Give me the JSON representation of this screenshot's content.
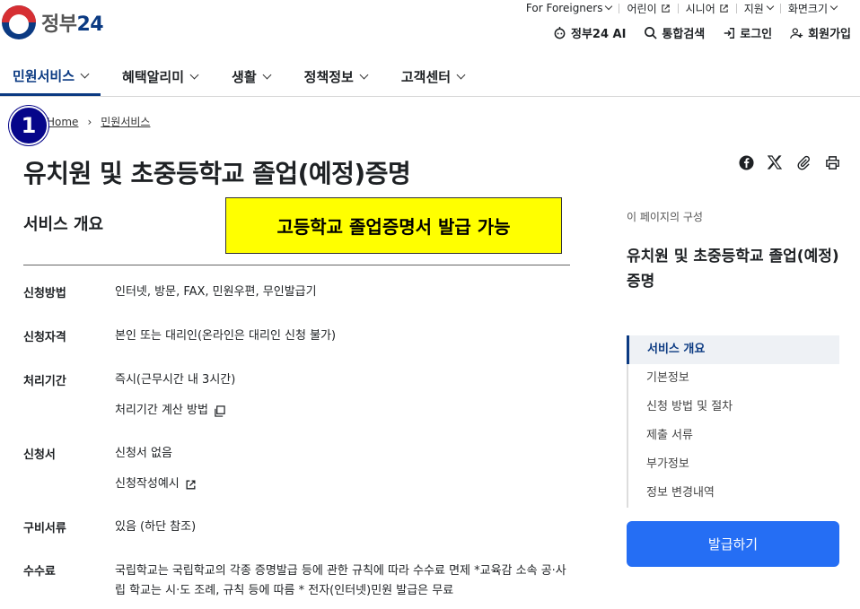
{
  "top_util": {
    "items": [
      {
        "label": "For Foreigners",
        "icon": "chevron-down-icon"
      },
      {
        "label": "어린이",
        "icon": "external-link-icon"
      },
      {
        "label": "시니어",
        "icon": "external-link-icon"
      },
      {
        "label": "지원",
        "icon": "chevron-down-icon"
      },
      {
        "label": "화면크기",
        "icon": "chevron-down-icon"
      }
    ]
  },
  "logo": {
    "text_a": "정부",
    "text_b": "24"
  },
  "util2": {
    "ai": "정부24 AI",
    "search": "통합검색",
    "login": "로그인",
    "signup": "회원가입"
  },
  "gnb": {
    "items": [
      "민원서비스",
      "혜택알리미",
      "생활",
      "정책정보",
      "고객센터"
    ]
  },
  "breadcrumb": {
    "home": "Home",
    "current": "민원서비스"
  },
  "step_badge": "1",
  "page_title": "유치원 및 초중등학교 졸업(예정)증명",
  "section_title": "서비스 개요",
  "highlight": "고등학교 졸업증명서 발급 가능",
  "rows": [
    {
      "key": "신청방법",
      "values": [
        "인터넷, 방문, FAX, 민원우편, 무인발급기"
      ]
    },
    {
      "key": "신청자격",
      "values": [
        "본인 또는 대리인(온라인은 대리인 신청 불가)"
      ]
    },
    {
      "key": "처리기간",
      "values": [
        "즉시(근무시간 내 3시간)",
        "처리기간 계산 방법"
      ]
    },
    {
      "key": "신청서",
      "values": [
        "신청서 없음",
        "신청작성예시"
      ]
    },
    {
      "key": "구비서류",
      "values": [
        "있음 (하단 참조)"
      ]
    },
    {
      "key": "수수료",
      "values": [
        "국립학교는 국립학교의 각종 증명발급 등에 관한 규칙에 따라 수수료 면제 *교육감 소속 공·사립 학교는 시·도 조례, 규칙 등에 따름 * 전자(인터넷)민원 발급은 무료"
      ]
    }
  ],
  "side": {
    "label": "이 페이지의 구성",
    "title": "유치원 및 초중등학교 졸업(예정)증명",
    "toc": [
      "서비스 개요",
      "기본정보",
      "신청 방법 및 절차",
      "제출 서류",
      "부가정보",
      "정보 변경내역"
    ]
  },
  "issue_button": "발급하기",
  "colors": {
    "brand": "#0b3a82",
    "accent_red": "#d62f33",
    "button": "#256ef4",
    "highlight": "#ffff00"
  }
}
